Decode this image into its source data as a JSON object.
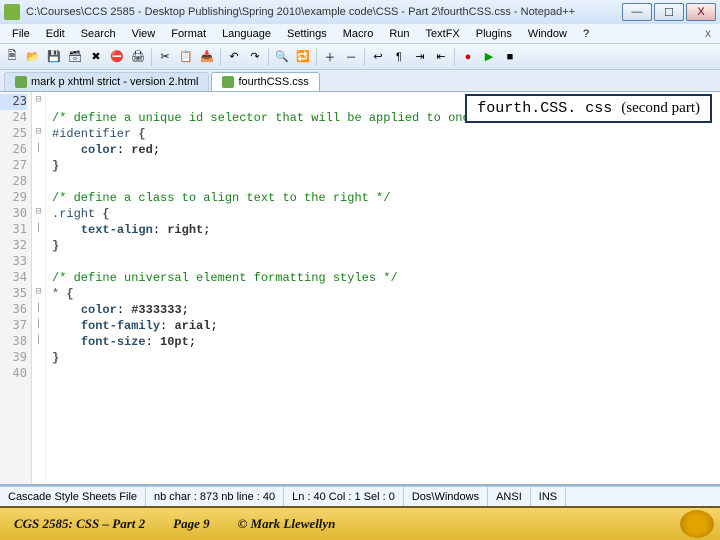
{
  "window": {
    "title": "C:\\Courses\\CCS 2585 - Desktop Publishing\\Spring 2010\\example code\\CSS - Part 2\\fourthCSS.css - Notepad++"
  },
  "winbtns": {
    "min": "—",
    "max": "☐",
    "close": "X"
  },
  "menu": {
    "file": "File",
    "edit": "Edit",
    "search": "Search",
    "view": "View",
    "format": "Format",
    "language": "Language",
    "settings": "Settings",
    "macro": "Macro",
    "run": "Run",
    "textfx": "TextFX",
    "plugins": "Plugins",
    "window": "Window",
    "help": "?"
  },
  "tabs": {
    "inactive": "mark p xhtml strict - version 2.html",
    "active": "fourthCSS.css"
  },
  "annotation": {
    "file": "fourth.CSS. css ",
    "note": "(second part)"
  },
  "gutter": [
    "23",
    "24",
    "25",
    "26",
    "27",
    "28",
    "29",
    "30",
    "31",
    "32",
    "33",
    "34",
    "35",
    "36",
    "37",
    "38",
    "39",
    "40"
  ],
  "fold": [
    "⊟",
    "",
    "⊟",
    "|",
    "",
    "",
    "",
    "⊟",
    "|",
    "",
    "",
    "",
    "⊟",
    "|",
    "|",
    "|",
    "",
    ""
  ],
  "code": {
    "l23": "",
    "l24": "/* define a unique id selector that will be applied to one element within the document */",
    "l25": {
      "sel": "#identifier",
      "br": "{"
    },
    "l26": {
      "prop": "color",
      "val": "red"
    },
    "l27": "}",
    "l28": "",
    "l29": "/* define a class to align text to the right */",
    "l30": {
      "sel": ".right",
      "br": "{"
    },
    "l31": {
      "prop": "text-align",
      "val": "right"
    },
    "l32": "}",
    "l33": "",
    "l34": "/* define universal element formatting styles */",
    "l35": {
      "sel": "*",
      "br": "{"
    },
    "l36": {
      "prop": "color",
      "val": "#333333"
    },
    "l37": {
      "prop": "font-family",
      "val": "arial"
    },
    "l38": {
      "prop": "font-size",
      "val": "10pt"
    },
    "l39": "}",
    "l40": ""
  },
  "status": {
    "lang": "Cascade Style Sheets File",
    "chars": "nb char : 873   nb line : 40",
    "pos": "Ln : 40   Col : 1   Sel : 0",
    "eol": "Dos\\Windows",
    "enc": "ANSI",
    "ins": "INS"
  },
  "footer": {
    "left": "CGS 2585: CSS – Part 2",
    "page": "Page 9",
    "copy": "© Mark Llewellyn"
  }
}
